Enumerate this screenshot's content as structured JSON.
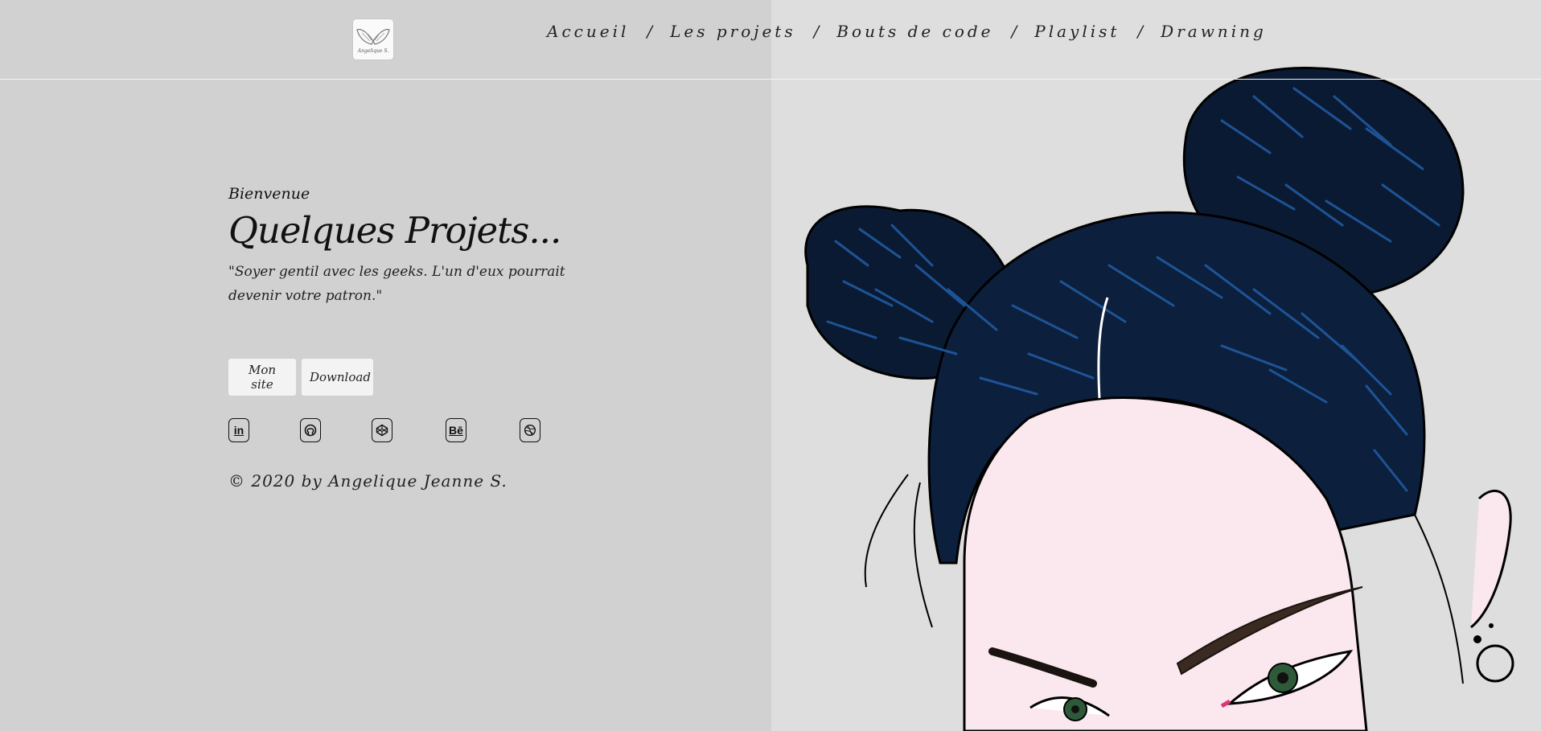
{
  "header": {
    "logo_alt": "Angelique S.",
    "nav": [
      {
        "label": "Accueil"
      },
      {
        "label": "Les projets"
      },
      {
        "label": "Bouts de code"
      },
      {
        "label": "Playlist"
      },
      {
        "label": "Drawning"
      }
    ],
    "separator": "/"
  },
  "hero": {
    "kicker": "Bienvenue",
    "title": "Quelques Projets...",
    "quote": "\"Soyer gentil avec les geeks. L'un d'eux pourrait devenir votre patron.\""
  },
  "buttons": {
    "site_label": "Mon site",
    "download_label": "Download"
  },
  "socials": [
    {
      "icon": "linkedin-icon",
      "glyph": "in"
    },
    {
      "icon": "github-icon",
      "glyph": ""
    },
    {
      "icon": "codepen-icon",
      "glyph": ""
    },
    {
      "icon": "behance-icon",
      "glyph": "Bē"
    },
    {
      "icon": "dribbble-icon",
      "glyph": ""
    }
  ],
  "footer": {
    "copyright": "© 2020 by Angelique Jeanne S."
  },
  "colors": {
    "left_bg": "#d1d1d1",
    "right_bg": "#dedede",
    "hair": "#0d1f3c",
    "hair_highlight": "#1e4f8f",
    "skin": "#fbe8ee"
  }
}
